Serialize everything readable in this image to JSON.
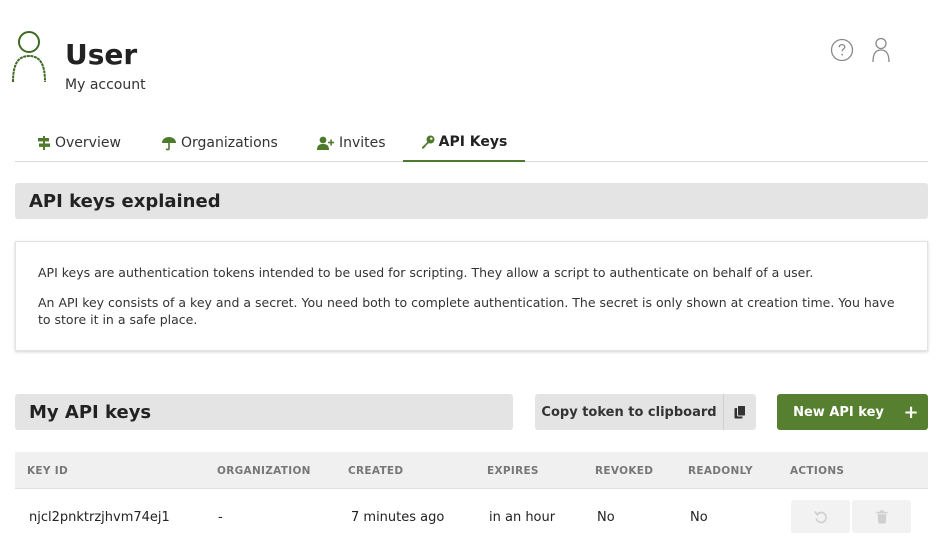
{
  "header": {
    "title": "User",
    "subtitle": "My account",
    "avatar_icon": "user-outline-icon",
    "help_icon": "question-circle-icon",
    "user_menu_icon": "user-icon"
  },
  "tabs": [
    {
      "label": "Overview",
      "icon": "signpost-icon",
      "active": false
    },
    {
      "label": "Organizations",
      "icon": "umbrella-icon",
      "active": false
    },
    {
      "label": "Invites",
      "icon": "user-plus-icon",
      "active": false
    },
    {
      "label": "API Keys",
      "icon": "key-icon",
      "active": true
    }
  ],
  "explain": {
    "heading": "API keys explained",
    "p1": "API keys are authentication tokens intended to be used for scripting. They allow a script to authenticate on behalf of a user.",
    "p2": "An API key consists of a key and a secret. You need both to complete authentication. The secret is only shown at creation time. You have to store it in a safe place."
  },
  "my_keys": {
    "heading": "My API keys",
    "copy_button": "Copy token to clipboard",
    "copy_icon": "clipboard-icon",
    "new_button": "New API key",
    "new_icon": "plus-icon"
  },
  "table": {
    "columns": [
      "KEY ID",
      "ORGANIZATION",
      "CREATED",
      "EXPIRES",
      "REVOKED",
      "READONLY",
      "ACTIONS"
    ],
    "rows": [
      {
        "key_id": "njcl2pnktrzjhvm74ej1",
        "organization": "-",
        "created": "7 minutes ago",
        "expires": "in an hour",
        "revoked": "No",
        "readonly": "No",
        "actions": [
          "revoke-icon",
          "trash-icon"
        ]
      }
    ]
  },
  "colors": {
    "accent": "#56802f",
    "tab_underline": "#4e7a2c",
    "section_bg": "#e4e4e4"
  }
}
